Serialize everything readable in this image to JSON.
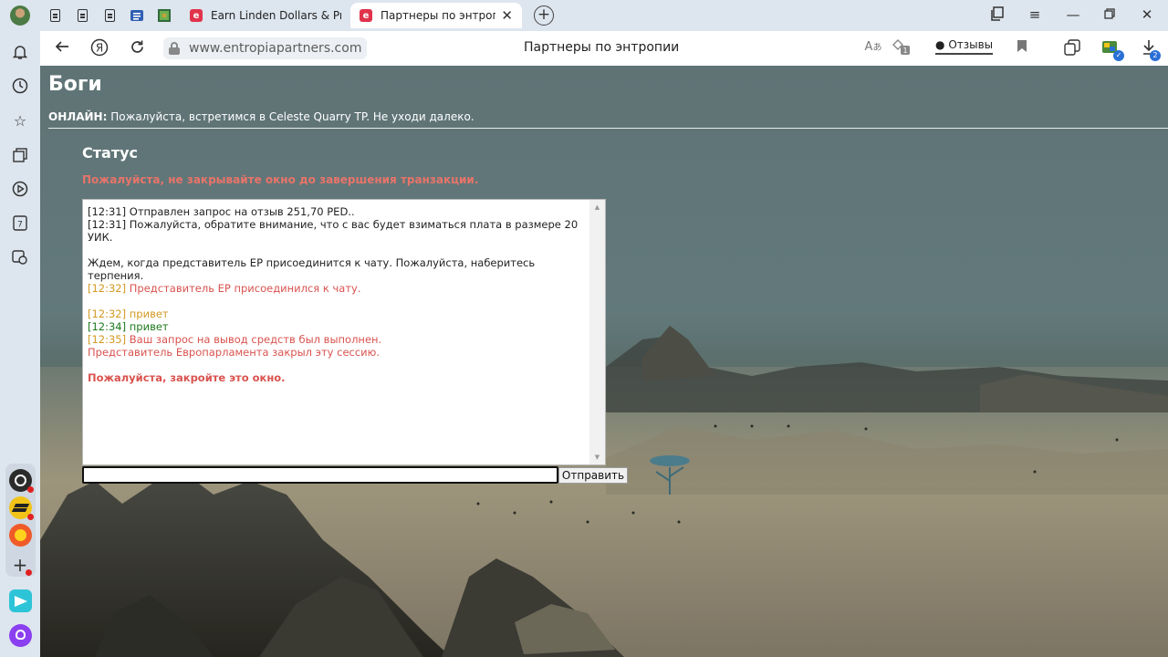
{
  "browser": {
    "tabs": [
      {
        "label": "Earn Linden Dollars & Proje"
      },
      {
        "label": "Партнеры по энтропии"
      }
    ],
    "url": "www.entropiapartners.com",
    "page_title": "Партнеры по энтропии",
    "reviews_label": "Отзывы",
    "downloads_badge": "2"
  },
  "page": {
    "heading": "Боги",
    "online_label": "ОНЛАЙН:",
    "online_text": " Пожалуйста, встретимся в Celeste Quarry TP. Не уходи далеко.",
    "status_heading": "Статус",
    "warning": "Пожалуйста, не закрывайте окно до завершения транзакции.",
    "chat": {
      "l1": "[12:31] Отправлен запрос на отзыв 251,70 PED..",
      "l2": "[12:31] Пожалуйста, обратите внимание, что с вас будет взиматься плата в размере 20 УИК.",
      "l3": "Ждем, когда представитель EP присоединится к чату. Пожалуйста, наберитесь терпения.",
      "l4_time": "[12:32]",
      "l4_text": " Представитель EP присоединился к чату.",
      "l5_time": "[12:32]",
      "l5_text": " привет",
      "l6_time": "[12:34]",
      "l6_text": " привет",
      "l7_time": "[12:35]",
      "l7_text": " Ваш запрос на вывод средств был выполнен.",
      "l8": "Представитель Европарламента закрыл эту сессию.",
      "l9": "Пожалуйста, закройте это окно."
    },
    "input_value": "",
    "send_label": "Отправить"
  }
}
